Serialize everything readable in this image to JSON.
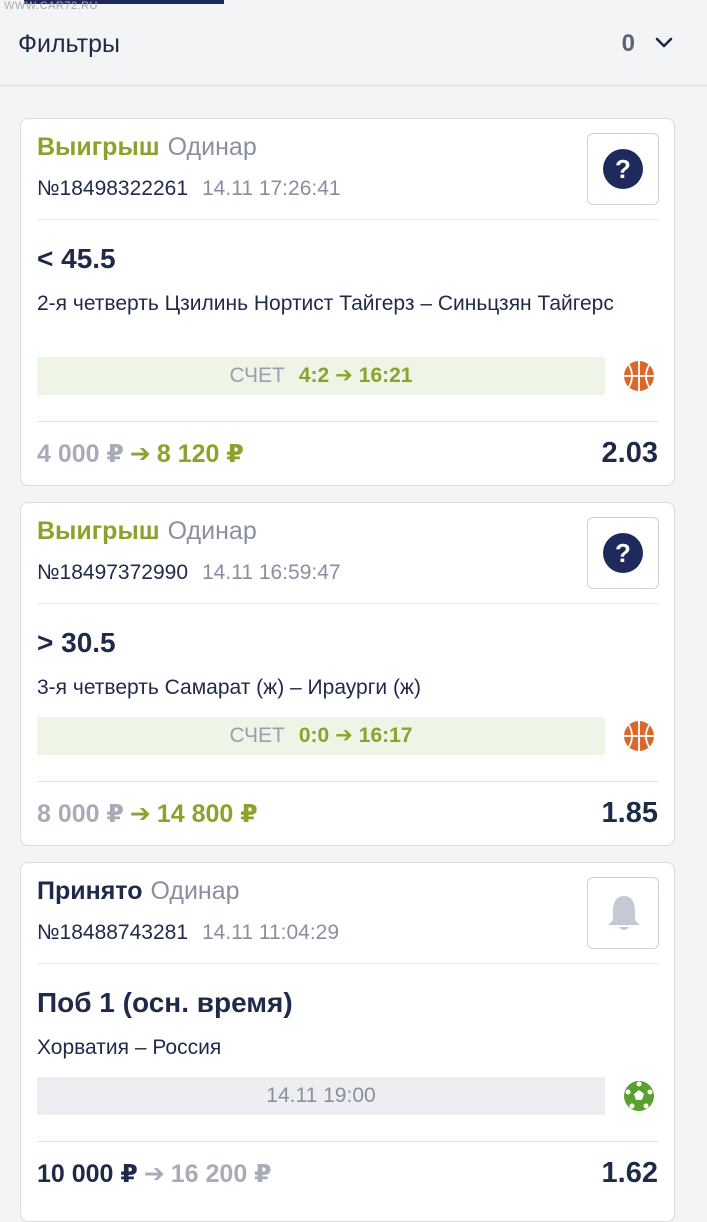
{
  "header": {
    "watermark": "WWW.CAR72.RU",
    "filters_label": "Фильтры",
    "filters_count": "0"
  },
  "bets": [
    {
      "status": "Выигрыш",
      "type": "Одинар",
      "id": "№18498322261",
      "time": "14.11 17:26:41",
      "action_icon": "question-icon",
      "selection": "< 45.5",
      "event": "2-я четверть Цзилинь Нортист Тайгерз – Синьцзян Тайгерс",
      "score_label": "СЧЕТ",
      "score_from": "4:2",
      "score_to": "16:21",
      "sport_icon": "basketball-icon",
      "stake": "4 000 ₽",
      "payout": "8 120 ₽",
      "odds": "2.03"
    },
    {
      "status": "Выигрыш",
      "type": "Одинар",
      "id": "№18497372990",
      "time": "14.11 16:59:47",
      "action_icon": "question-icon",
      "selection": "> 30.5",
      "event": "3-я четверть Самарат (ж) – Ираурги (ж)",
      "score_label": "СЧЕТ",
      "score_from": "0:0",
      "score_to": "16:17",
      "sport_icon": "basketball-icon",
      "stake": "8 000 ₽",
      "payout": "14 800 ₽",
      "odds": "1.85"
    },
    {
      "status": "Принято",
      "type": "Одинар",
      "id": "№18488743281",
      "time": "14.11 11:04:29",
      "action_icon": "bell-icon",
      "selection": "Поб 1 (осн. время)",
      "event": "Хорватия – Россия",
      "start_time": "14.11 19:00",
      "sport_icon": "football-icon",
      "stake": "10 000 ₽",
      "payout": "16 200 ₽",
      "odds": "1.62"
    }
  ],
  "colors": {
    "win_green": "#8aa32c",
    "navy": "#1f2a5c",
    "basketball_orange": "#d9692b",
    "football_green": "#5aa02c"
  }
}
